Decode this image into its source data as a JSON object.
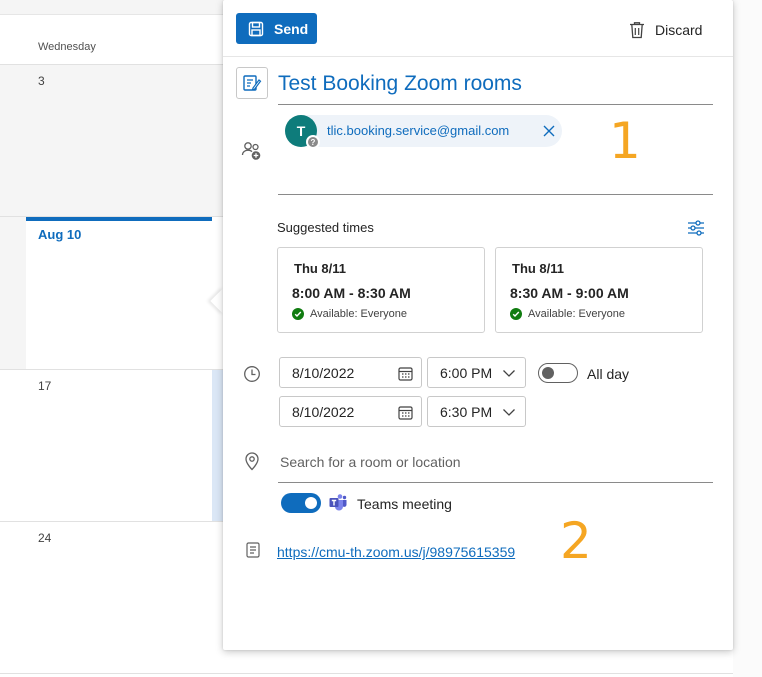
{
  "calendar": {
    "day_header": "Wednesday",
    "weeks": [
      {
        "day": "3"
      },
      {
        "day": "Aug 10"
      },
      {
        "day": "17"
      },
      {
        "day": "24"
      }
    ]
  },
  "toolbar": {
    "send_label": "Send",
    "discard_label": "Discard"
  },
  "event": {
    "title": "Test Booking Zoom rooms",
    "attendee": {
      "initial": "T",
      "presence": "?",
      "email": "tlic.booking.service@gmail.com"
    }
  },
  "suggested": {
    "label": "Suggested times",
    "cards": [
      {
        "day": "Thu 8/11",
        "time": "8:00 AM - 8:30 AM",
        "availability": "Available: Everyone"
      },
      {
        "day": "Thu 8/11",
        "time": "8:30 AM - 9:00 AM",
        "availability": "Available: Everyone"
      }
    ]
  },
  "schedule": {
    "start_date": "8/10/2022",
    "start_time": "6:00 PM",
    "end_date": "8/10/2022",
    "end_time": "6:30 PM",
    "all_day_label": "All day",
    "all_day_on": false
  },
  "location": {
    "placeholder": "Search for a room or location"
  },
  "teams": {
    "label": "Teams meeting",
    "on": true
  },
  "notes": {
    "link": "https://cmu-th.zoom.us/j/98975615359"
  },
  "annotations": [
    "1",
    "2"
  ],
  "colors": {
    "accent": "#0f6cbd",
    "annotation": "#f5a623",
    "avatar": "#0e7c7b",
    "available": "#107c10"
  }
}
